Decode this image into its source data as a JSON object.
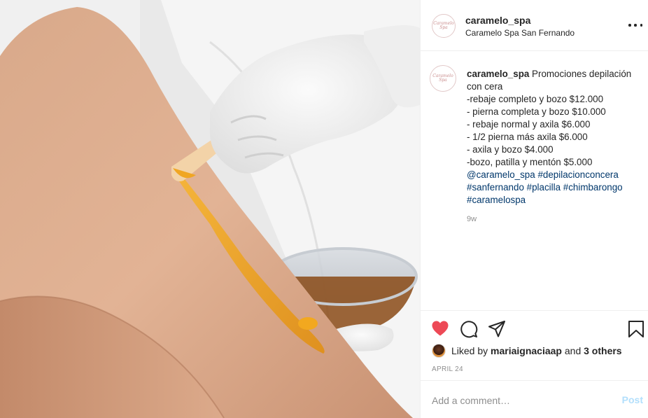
{
  "post": {
    "image_alt": "waxing",
    "header": {
      "username": "caramelo_spa",
      "location": "Caramelo Spa San Fernando",
      "avatar_text": "Caramelo Spa"
    },
    "caption": {
      "username": "caramelo_spa",
      "first_line": " Promociones depilación",
      "lines": [
        "con cera",
        "-rebaje completo y bozo $12.000",
        "- pierna completa y bozo $10.000",
        "- rebaje normal y axila $6.000",
        "- 1/2 pierna más axila $6.000",
        "- axila y bozo $4.000",
        "-bozo, patilla y mentón $5.000"
      ],
      "tags_line1": [
        "@caramelo_spa",
        "#depilacionconcera"
      ],
      "tags_line2": [
        "#sanfernando",
        "#placilla",
        "#chimbarongo"
      ],
      "tags_line3": [
        "#caramelospa"
      ]
    },
    "time_ago": "9w",
    "likes": {
      "prefix": "Liked by ",
      "user": "mariaignaciaap",
      "middle": " and ",
      "others": "3 others"
    },
    "date": "APRIL 24",
    "comment": {
      "placeholder": "Add a comment…",
      "post_label": "Post"
    },
    "icons": {
      "like": "heart-icon",
      "comment": "comment-icon",
      "share": "share-icon",
      "save": "bookmark-icon",
      "more": "more-icon"
    },
    "colors": {
      "like_red": "#ed4956",
      "hashtag_blue": "#00376b",
      "post_disabled": "#b2dffc",
      "muted": "#8e8e8e"
    }
  }
}
